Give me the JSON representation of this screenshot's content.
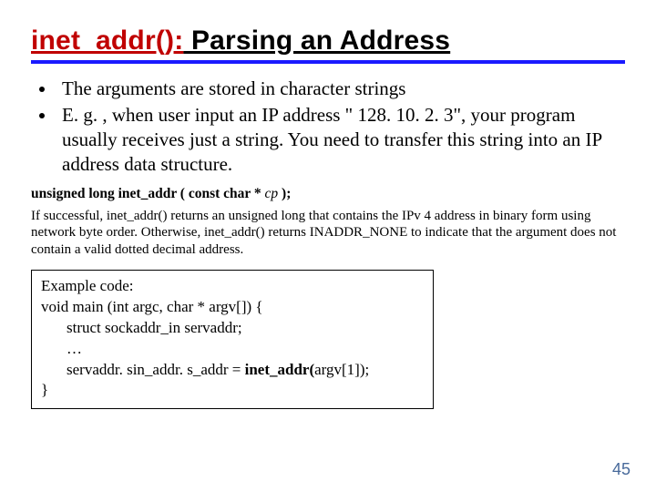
{
  "title": {
    "func": "inet_addr():",
    "rest": " Parsing an Address"
  },
  "bullets": [
    "The arguments are stored in character strings",
    "E. g. , when user input an IP address \" 128. 10. 2. 3\", your program usually receives just a string. You need to transfer this string into an IP address data structure."
  ],
  "proto": {
    "prefix": "unsigned long inet_addr ( const char *",
    "param": " cp ",
    "suffix": ");"
  },
  "desc": "If successful, inet_addr() returns an unsigned long that contains the IPv 4 address in binary form using network byte order. Otherwise, inet_addr() returns INADDR_NONE to indicate that the argument does not contain a valid dotted decimal address.",
  "code": {
    "l1": "Example code:",
    "l2": "void main (int argc, char * argv[]) {",
    "l3": "struct sockaddr_in servaddr;",
    "l4": "…",
    "l5a": "servaddr. sin_addr. s_addr = ",
    "l5b": "inet_addr(",
    "l5c": "argv[1]);",
    "l6": "}"
  },
  "page_number": "45"
}
